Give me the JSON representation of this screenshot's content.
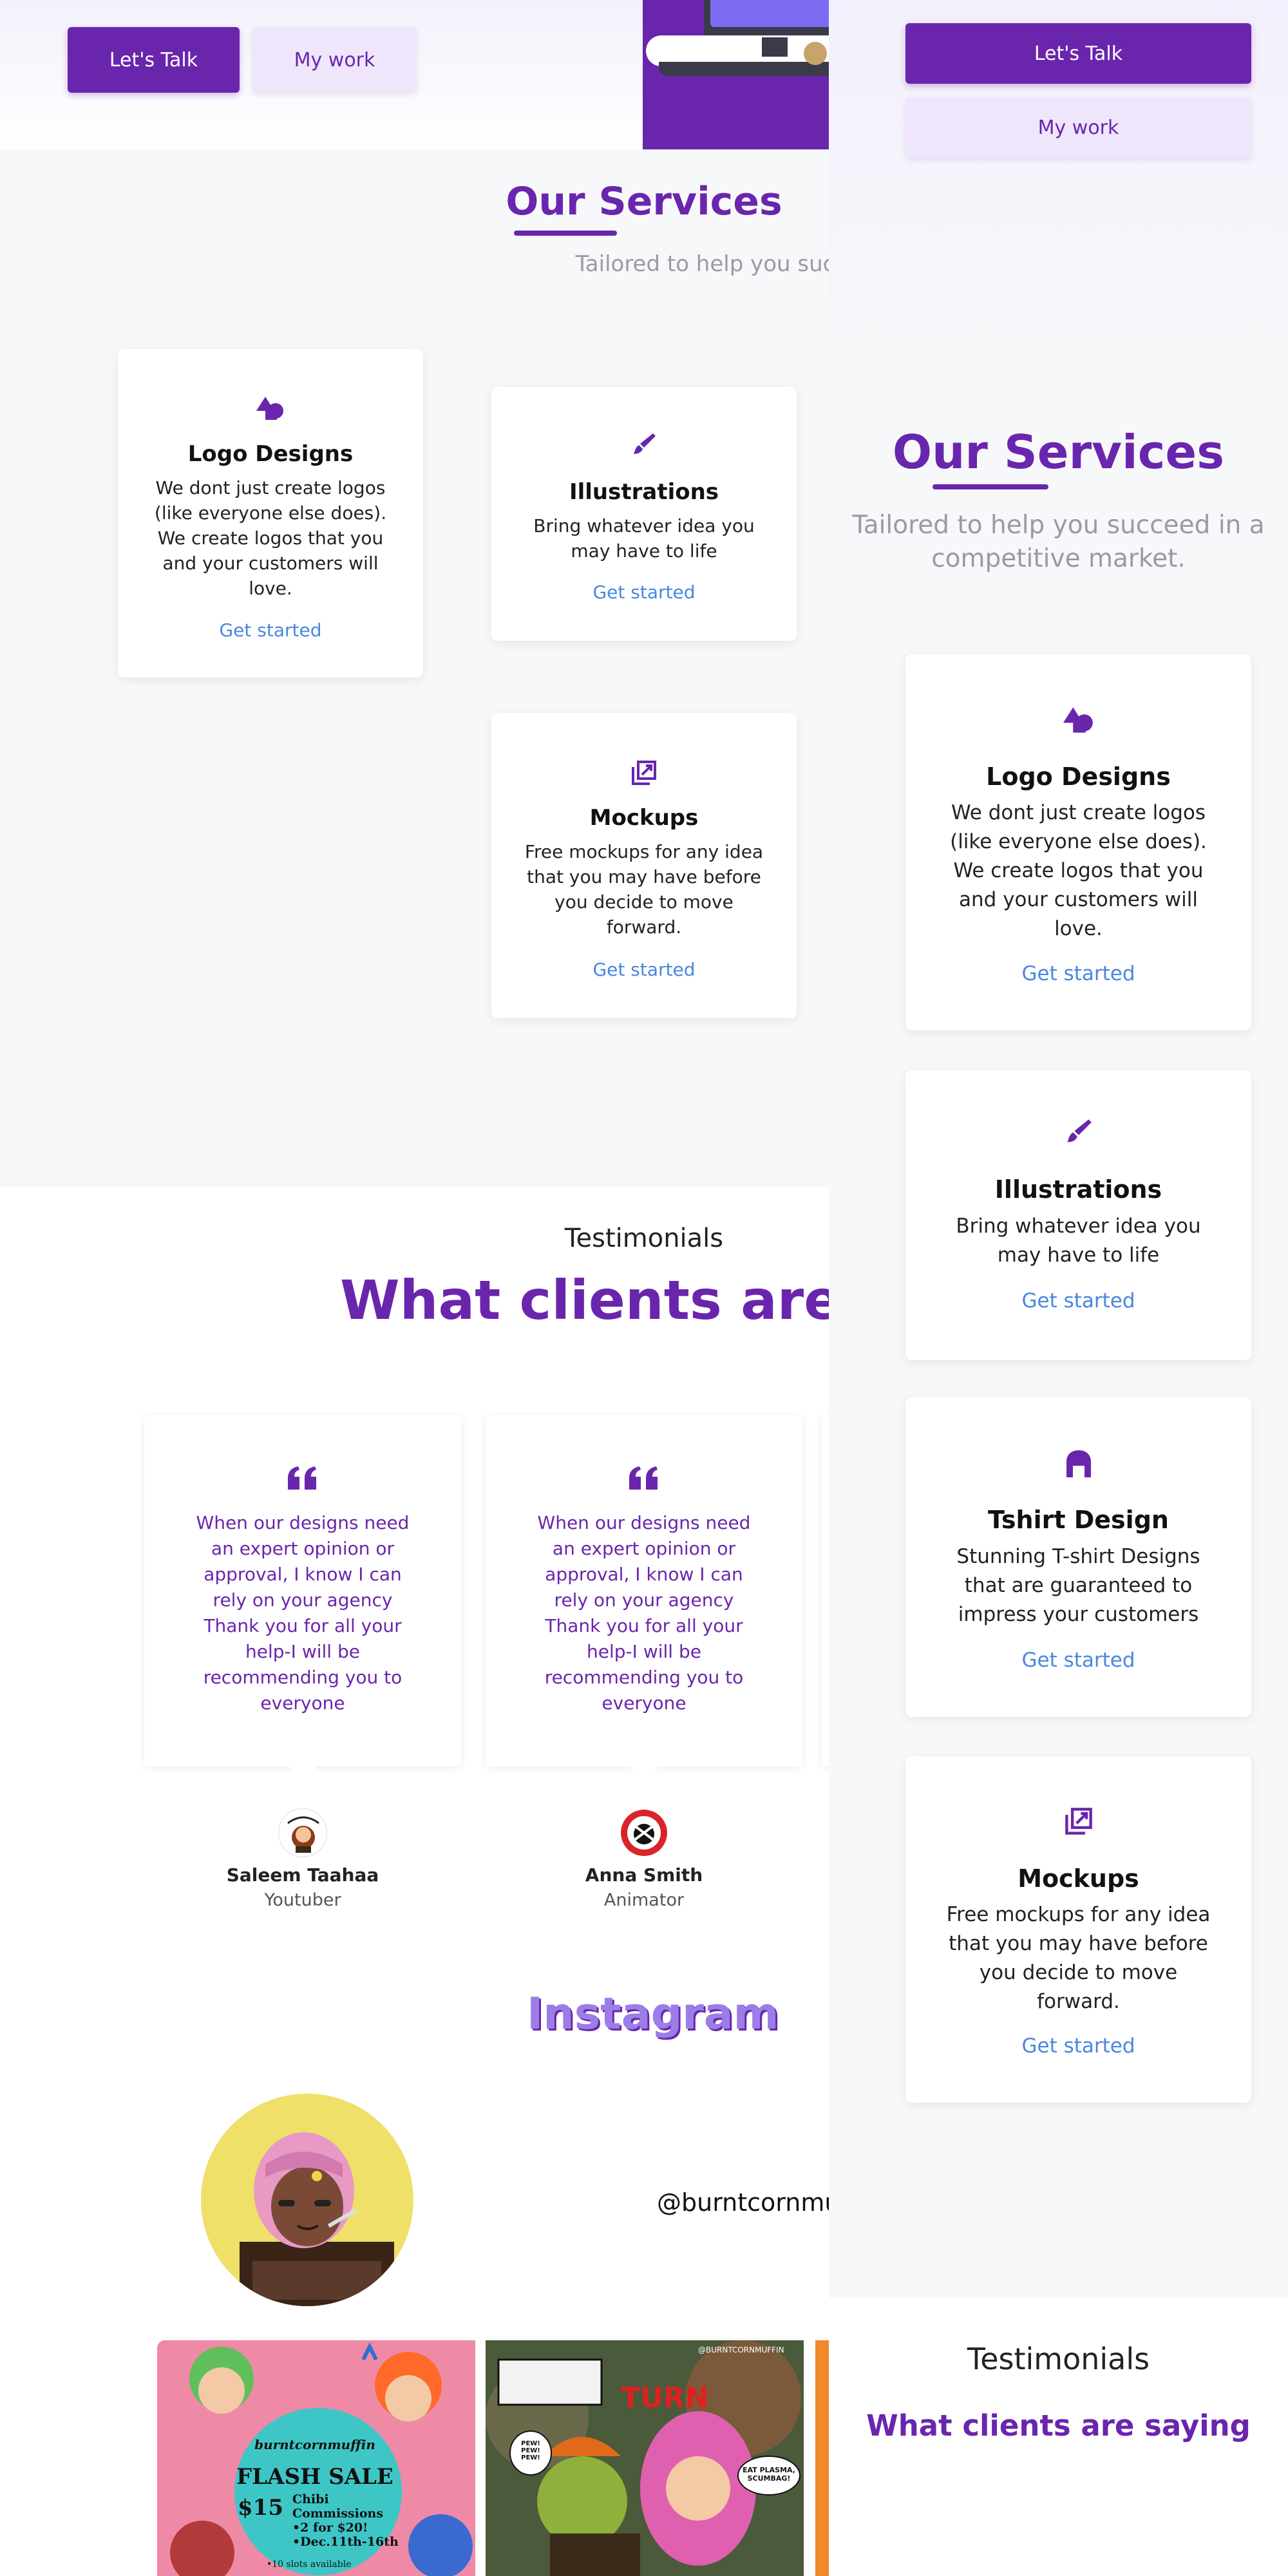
{
  "colors": {
    "brand": "#6a25ad",
    "link": "#4a86e0",
    "muted": "#9a9aa6",
    "insta": "#9b7de8"
  },
  "hero": {
    "cta_primary": "Let's Talk",
    "cta_secondary": "My work"
  },
  "services": {
    "title": "Our Services",
    "subtitle_desktop": "Tailored to help you succeed in a competitiv",
    "subtitle_mobile_line1": "Tailored to help you succeed in a",
    "subtitle_mobile_line2": "competitive market.",
    "items": [
      {
        "icon": "shapes-icon",
        "title": "Logo Designs",
        "lines": [
          "We dont just create logos",
          "(like everyone else does).",
          "We create logos that you",
          "and your customers will",
          "love."
        ],
        "link": "Get started"
      },
      {
        "icon": "brush-icon",
        "title": "Illustrations",
        "lines": [
          "Bring whatever idea you",
          "may have to life"
        ],
        "link": "Get started"
      },
      {
        "icon": "tshirt-icon",
        "title": "Tshirt Design",
        "lines": [
          "Stunning T-shirt Designs",
          "that are guaranteed to",
          "impress your customers"
        ],
        "link": "Get started"
      },
      {
        "icon": "mockup-icon",
        "title": "Mockups",
        "lines": [
          "Free mockups for any idea",
          "that you may have before",
          "you decide to move",
          "forward."
        ],
        "link": "Get started"
      }
    ]
  },
  "testimonials": {
    "eyebrow": "Testimonials",
    "title_desktop": "What clients are sa",
    "title_mobile": "What clients are saying",
    "items": [
      {
        "lines": [
          "When our designs need",
          "an expert opinion or",
          "approval, I know I can",
          "rely on your agency",
          "Thank you for all your",
          "help-I will be",
          "recommending you to",
          "everyone"
        ],
        "name": "Saleem Taahaa",
        "role": "Youtuber"
      },
      {
        "lines": [
          "When our designs need",
          "an expert opinion or",
          "approval, I know I can",
          "rely on your agency",
          "Thank you for all your",
          "help-I will be",
          "recommending you to",
          "everyone"
        ],
        "name": "Anna Smith",
        "role": "Animator"
      }
    ]
  },
  "instagram": {
    "title": "Instagram",
    "handle": "@burntcornmuf",
    "posts": [
      {
        "name": "burntcornmuffin",
        "headline": "FLASH SALE",
        "price": "$15",
        "lines": [
          "Chibi",
          "Commissions",
          "•2 for $20!",
          "•Dec.11th-16th",
          "•10 slots available"
        ]
      },
      {
        "name": "@BURNTCORNMUFFIN",
        "headline": "TURN",
        "lines": [
          "PEW! PEW! PEW!",
          "EAT PLASMA, SCUMBAG!"
        ]
      }
    ]
  }
}
